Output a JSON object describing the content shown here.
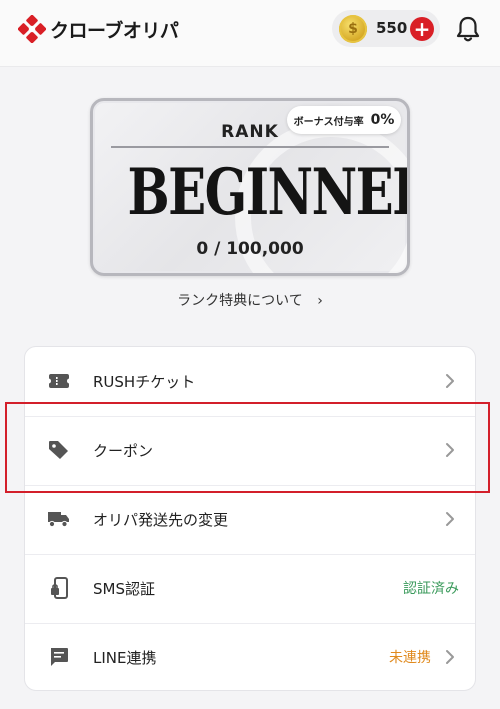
{
  "header": {
    "logo_text": "クローブオリパ",
    "coin_count": "550",
    "add_label": "+"
  },
  "rank": {
    "label": "RANK",
    "name": "BEGINNER",
    "progress": "0 / 100,000",
    "bonus_label": "ボーナス付与率",
    "bonus_value": "0%"
  },
  "rank_benefits": {
    "label": "ランク特典について",
    "chevron": "›"
  },
  "menu": {
    "items": [
      {
        "label": "RUSHチケット",
        "icon": "ticket-icon"
      },
      {
        "label": "クーポン",
        "icon": "tag-icon"
      },
      {
        "label": "オリパ発送先の変更",
        "icon": "truck-icon"
      },
      {
        "label": "SMS認証",
        "icon": "phone-lock-icon",
        "status": "認証済み",
        "status_color": "#3a9a5b"
      },
      {
        "label": "LINE連携",
        "icon": "chat-icon",
        "status": "未連携",
        "status_color": "#e08a1e"
      }
    ]
  },
  "colors": {
    "brand_red": "#d91f26",
    "highlight": "#d31f2a"
  }
}
